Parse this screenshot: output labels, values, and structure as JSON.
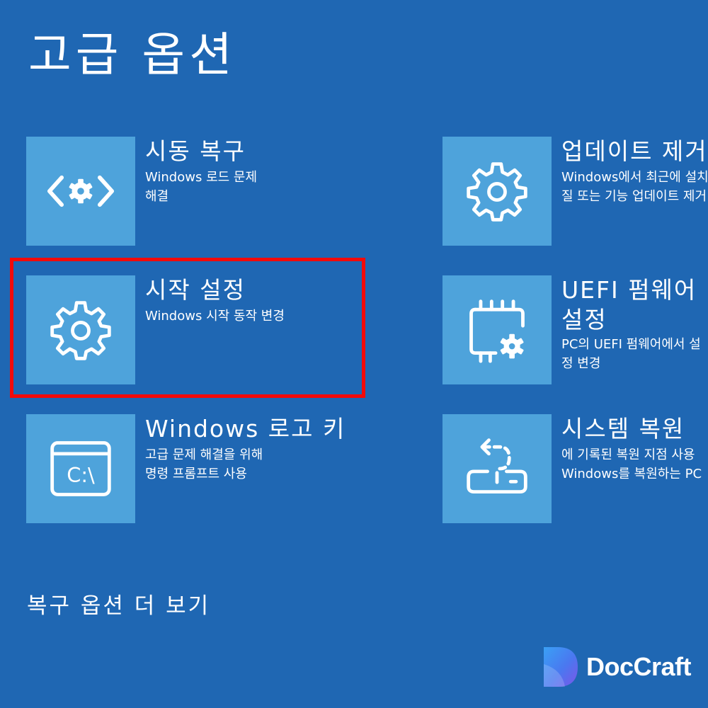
{
  "page": {
    "title": "고급 옵션",
    "more_options": "복구 옵션 더 보기"
  },
  "options": [
    {
      "id": "startup-repair",
      "title": "시동 복구",
      "desc": [
        "Windows 로드 문제",
        "해결"
      ],
      "icon": "startup-repair-icon"
    },
    {
      "id": "uninstall-updates",
      "title": "업데이트 제거",
      "desc": [
        "Windows에서 최근에 설치된",
        "질 또는 기능 업데이트 제거"
      ],
      "icon": "gear-icon"
    },
    {
      "id": "startup-settings",
      "title": "시작 설정",
      "desc": [
        "Windows 시작 동작 변경"
      ],
      "icon": "gear-icon"
    },
    {
      "id": "uefi-firmware",
      "title": "UEFI 펌웨어 설정",
      "desc": [
        "PC의 UEFI 펌웨어에서 설",
        "정 변경"
      ],
      "icon": "chip-gear-icon"
    },
    {
      "id": "command-prompt",
      "title": "Windows 로고 키",
      "desc": [
        "고급 문제 해결을 위해",
        "명령 프롬프트 사용"
      ],
      "icon": "command-prompt-icon"
    },
    {
      "id": "system-restore",
      "title": "시스템 복원",
      "desc": [
        "에 기록된 복원 지점 사용",
        "Windows를 복원하는 PC"
      ],
      "icon": "system-restore-icon"
    }
  ],
  "highlight": {
    "target": "startup-settings",
    "color": "#f30a0a"
  },
  "brand": {
    "name": "DocCraft"
  },
  "colors": {
    "background": "#1f67b3",
    "tile": "#4ea3db",
    "text": "#ffffff"
  }
}
